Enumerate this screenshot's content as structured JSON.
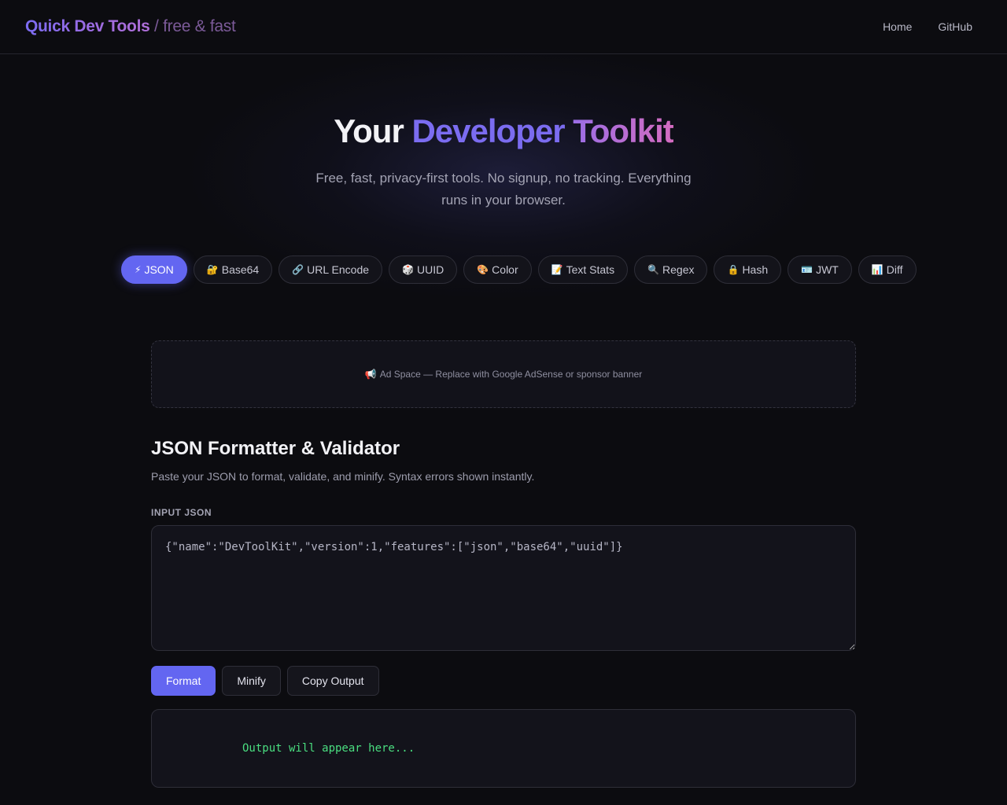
{
  "header": {
    "brand_name": "Quick Dev Tools",
    "brand_tagline": "/ free & fast",
    "nav": [
      {
        "label": "Home"
      },
      {
        "label": "GitHub"
      }
    ]
  },
  "hero": {
    "title_word1": "Your",
    "title_word2": "Developer",
    "title_word3": "Toolkit",
    "subtitle": "Free, fast, privacy-first tools. No signup, no tracking. Everything runs in your browser."
  },
  "tabs": [
    {
      "icon": "⚡",
      "label": "JSON",
      "active": true
    },
    {
      "icon": "🔐",
      "label": "Base64"
    },
    {
      "icon": "🔗",
      "label": "URL Encode"
    },
    {
      "icon": "🎲",
      "label": "UUID"
    },
    {
      "icon": "🎨",
      "label": "Color"
    },
    {
      "icon": "📝",
      "label": "Text Stats"
    },
    {
      "icon": "🔍",
      "label": "Regex"
    },
    {
      "icon": "🔒",
      "label": "Hash"
    },
    {
      "icon": "🪪",
      "label": "JWT"
    },
    {
      "icon": "📊",
      "label": "Diff"
    }
  ],
  "ad": {
    "icon": "📢",
    "text": "Ad Space — Replace with Google AdSense or sponsor banner"
  },
  "tool": {
    "title": "JSON Formatter & Validator",
    "description": "Paste your JSON to format, validate, and minify. Syntax errors shown instantly.",
    "input_label": "INPUT JSON",
    "input_value": "{\"name\":\"DevToolKit\",\"version\":1,\"features\":[\"json\",\"base64\",\"uuid\"]}",
    "buttons": {
      "format": "Format",
      "minify": "Minify",
      "copy": "Copy Output"
    },
    "output_placeholder": "Output will appear here..."
  },
  "colors": {
    "accent": "#6366f1",
    "background": "#0c0c10",
    "output_text": "#4ade80"
  }
}
